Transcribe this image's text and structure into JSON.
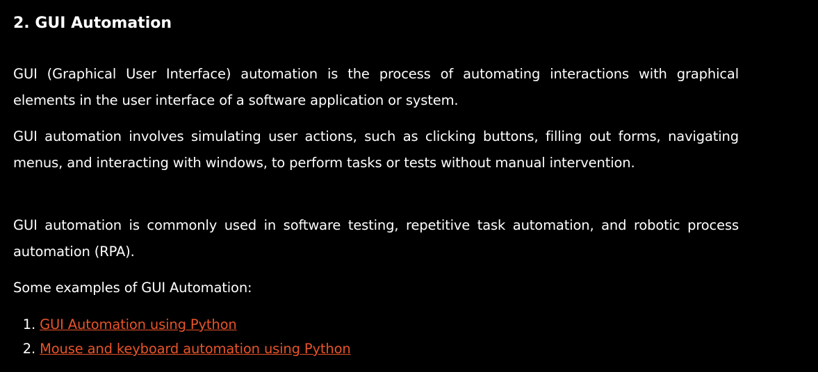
{
  "heading": "2. GUI Automation",
  "paragraphs": [
    "GUI (Graphical User Interface) automation is the process of automating interactions with graphical elements in the user interface of a software application or system.",
    "GUI automation involves simulating user actions, such as clicking buttons, filling out forms, navigating menus, and interacting with windows, to perform tasks or tests without manual intervention.",
    "GUI automation is commonly used in software testing, repetitive task automation, and robotic process automation (RPA).",
    "Some examples of GUI Automation:"
  ],
  "examples": [
    {
      "number": "1.",
      "label": "GUI Automation using Python"
    },
    {
      "number": "2.",
      "label": "Mouse and keyboard automation using Python"
    }
  ],
  "colors": {
    "background": "#000000",
    "text": "#ffffff",
    "link": "#e8542a"
  }
}
